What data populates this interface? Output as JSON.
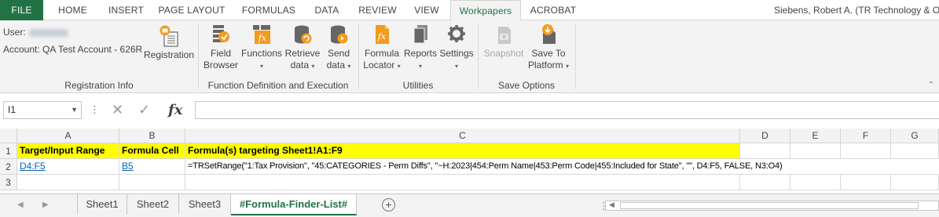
{
  "ribbon_tabs": [
    "FILE",
    "HOME",
    "INSERT",
    "PAGE LAYOUT",
    "FORMULAS",
    "DATA",
    "REVIEW",
    "VIEW",
    "Workpapers",
    "ACROBAT"
  ],
  "active_tab": "Workpapers",
  "user_display": "Siebens, Robert A. (TR Technology & Op",
  "registration_info": {
    "user_label": "User:",
    "account": "Account: QA Test Account - 626R",
    "registration_button": "Registration",
    "group_label": "Registration Info"
  },
  "function_group": {
    "field_browser": [
      "Field",
      "Browser"
    ],
    "functions": "Functions",
    "retrieve_data": [
      "Retrieve",
      "data"
    ],
    "send_data": [
      "Send",
      "data"
    ],
    "group_label": "Function Definition and Execution"
  },
  "utilities_group": {
    "formula_locator": [
      "Formula",
      "Locator"
    ],
    "reports": "Reports",
    "settings": "Settings",
    "group_label": "Utilities"
  },
  "save_group": {
    "snapshot": "Snapshot",
    "save_to_platform": [
      "Save To",
      "Platform"
    ],
    "group_label": "Save Options"
  },
  "name_box": "I1",
  "formula_bar": {
    "fx": "fx",
    "value": ""
  },
  "columns": [
    "A",
    "B",
    "C",
    "D",
    "E",
    "F",
    "G"
  ],
  "rows": [
    "1",
    "2",
    "3"
  ],
  "cells": {
    "A1": "Target/Input Range",
    "B1": "Formula Cell",
    "C1": "Formula(s) targeting Sheet1!A1:F9",
    "A2": "D4:F5",
    "B2": "B5",
    "C2": "=TRSetRange(\"1:Tax Provision\", \"45:CATEGORIES - Perm Diffs\", \"~H:2023|454:Perm Name|453:Perm Code|455:Included for State\", \"\", D4:F5, FALSE, N3:O4)"
  },
  "sheet_tabs": [
    "Sheet1",
    "Sheet2",
    "Sheet3",
    "#Formula-Finder-List#"
  ],
  "active_sheet": "#Formula-Finder-List#",
  "colors": {
    "excel_green": "#217346",
    "header_fill": "#ffff00",
    "link": "#0563c1",
    "icon_orange": "#f39a1f",
    "icon_gray": "#666666"
  }
}
